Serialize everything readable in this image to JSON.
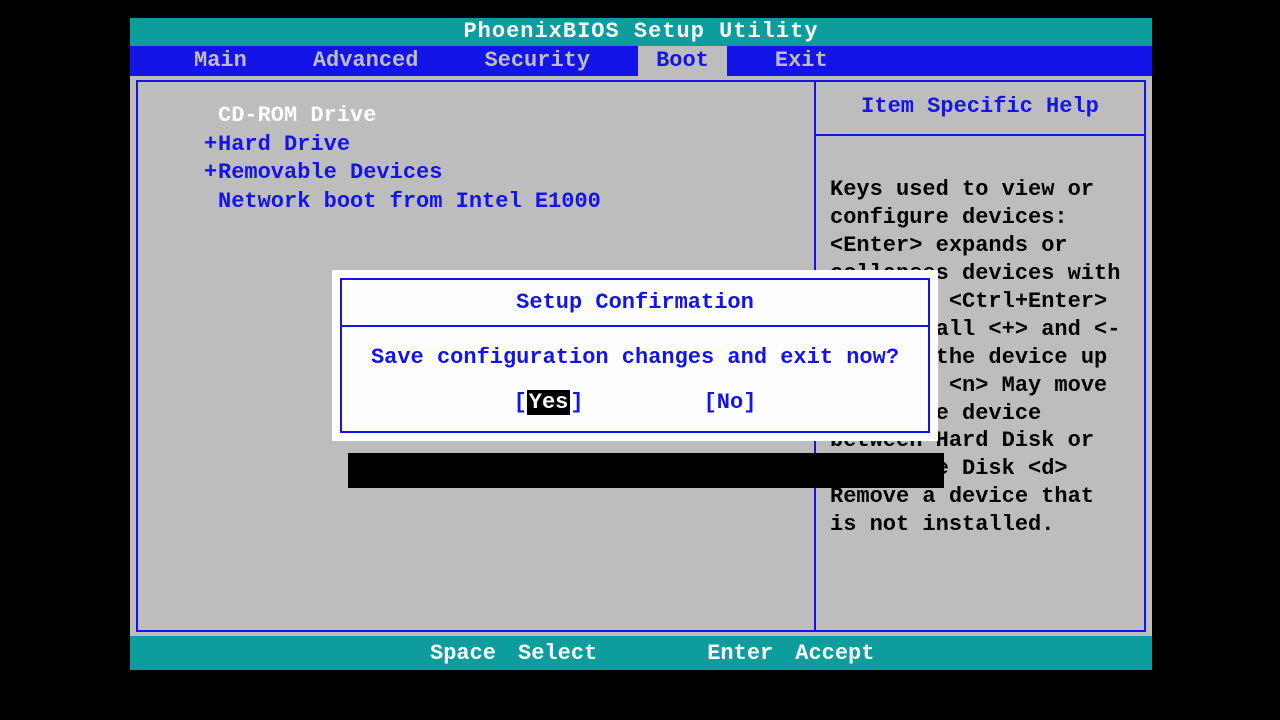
{
  "title": "PhoenixBIOS Setup Utility",
  "menu": {
    "items": [
      "Main",
      "Advanced",
      "Security",
      "Boot",
      "Exit"
    ],
    "selected_index": 3
  },
  "boot": {
    "items": [
      {
        "label": "CD-ROM Drive",
        "expandable": false,
        "highlighted": true
      },
      {
        "label": "Hard Drive",
        "expandable": true,
        "highlighted": false
      },
      {
        "label": "Removable Devices",
        "expandable": true,
        "highlighted": false
      },
      {
        "label": "Network boot from Intel E1000",
        "expandable": false,
        "highlighted": false
      }
    ]
  },
  "help": {
    "title": "Item Specific Help",
    "body": "Keys used to view or configure devices: <Enter> expands or collapses devices with a + or - <Ctrl+Enter> expands all <+> and <-> moves the device up or down. <n> May move removable device between Hard Disk or Removable Disk <d> Remove a device that is not installed."
  },
  "modal": {
    "title": "Setup Confirmation",
    "message": "Save configuration changes and exit now?",
    "yes": "Yes",
    "no": "No"
  },
  "footer": {
    "key1": "Space",
    "label1": "Select",
    "key2": "Enter",
    "label2": "Accept"
  }
}
